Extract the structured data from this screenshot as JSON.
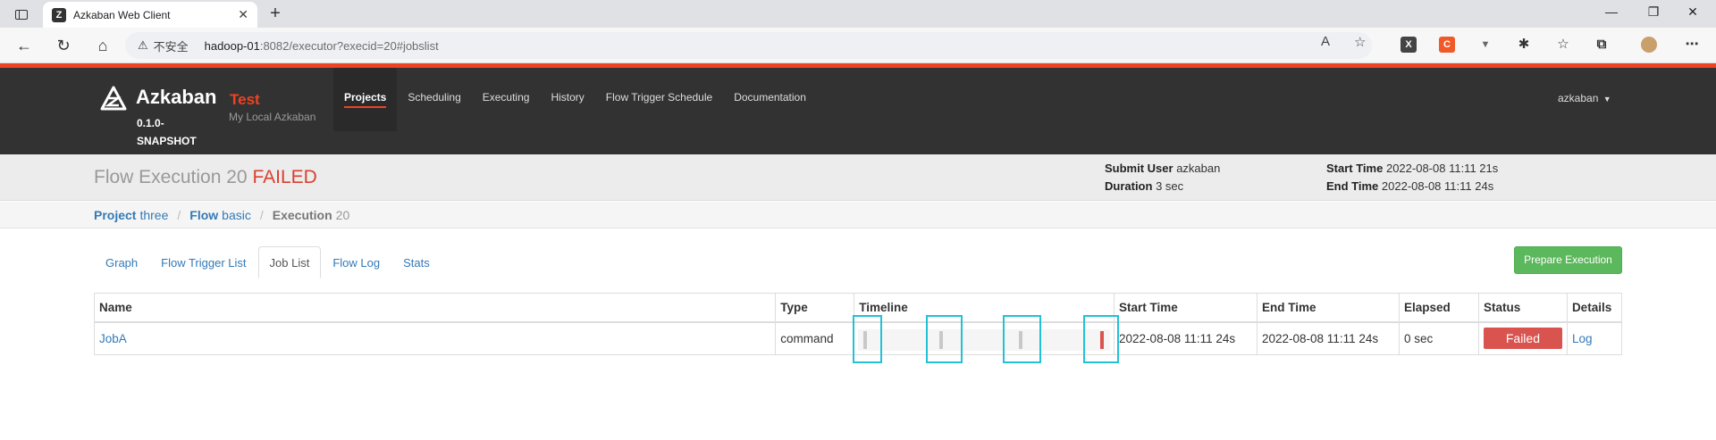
{
  "browser": {
    "tab_title": "Azkaban Web Client",
    "insecure_label": "不安全",
    "url_host": "hadoop-01",
    "url_rest": ":8082/executor?execid=20#jobslist"
  },
  "header": {
    "brand_name": "Azkaban",
    "brand_version": "0.1.0-SNAPSHOT",
    "env_name": "Test",
    "env_desc": "My Local Azkaban",
    "nav": [
      "Projects",
      "Scheduling",
      "Executing",
      "History",
      "Flow Trigger Schedule",
      "Documentation"
    ],
    "active_nav": "Projects",
    "user": "azkaban"
  },
  "flow": {
    "title": "Flow Execution 20",
    "status": "FAILED",
    "submit_user_label": "Submit User",
    "submit_user": "azkaban",
    "duration_label": "Duration",
    "duration": "3 sec",
    "start_time_label": "Start Time",
    "start_time": "2022-08-08 11:11 21s",
    "end_time_label": "End Time",
    "end_time": "2022-08-08 11:11 24s"
  },
  "breadcrumb": {
    "project_label": "Project",
    "project": "three",
    "flow_label": "Flow",
    "flow": "basic",
    "execution_label": "Execution",
    "execution": "20"
  },
  "tabs": [
    "Graph",
    "Flow Trigger List",
    "Job List",
    "Flow Log",
    "Stats"
  ],
  "active_tab": "Job List",
  "prepare_button": "Prepare Execution",
  "table": {
    "columns": [
      "Name",
      "Type",
      "Timeline",
      "Start Time",
      "End Time",
      "Elapsed",
      "Status",
      "Details"
    ],
    "rows": [
      {
        "name": "JobA",
        "type": "command",
        "start_time": "2022-08-08 11:11 24s",
        "end_time": "2022-08-08 11:11 24s",
        "elapsed": "0 sec",
        "status": "Failed",
        "details": "Log"
      }
    ]
  },
  "colors": {
    "accent": "#ee4322",
    "header_bg": "#323232",
    "failed": "#d9534f",
    "link": "#337ab7",
    "success_button": "#5cb85c",
    "highlight_box": "#21c2d6"
  }
}
